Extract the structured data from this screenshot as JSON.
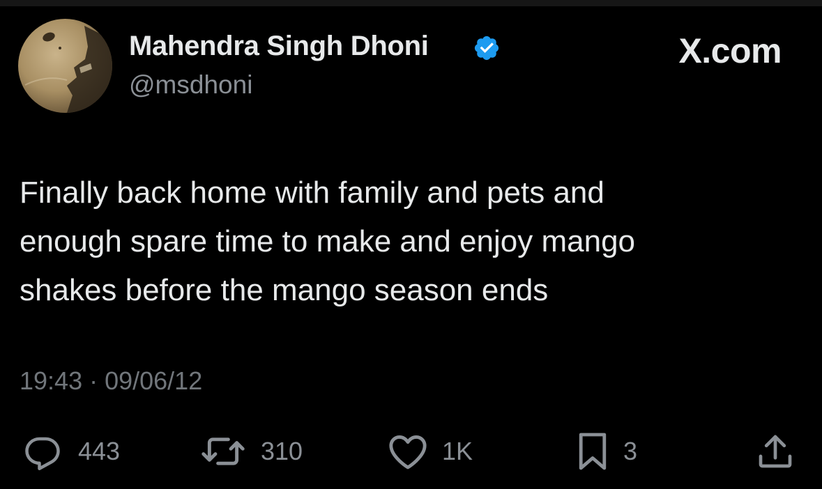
{
  "header": {
    "display_name": "Mahendra Singh Dhoni",
    "handle": "@msdhoni",
    "verified_icon": "verified-badge-icon",
    "brand": "X.com",
    "verified_color": "#1d9bf0"
  },
  "tweet": {
    "lines": [
      "Finally back home with family and pets and",
      "enough spare time to make and enjoy mango",
      "shakes before the mango season ends"
    ],
    "meta": "19:43 · 09/06/12"
  },
  "actions": {
    "reply": {
      "icon": "reply-icon",
      "count": "443"
    },
    "repost": {
      "icon": "repost-icon",
      "count": "310"
    },
    "like": {
      "icon": "heart-icon",
      "count": "1K"
    },
    "bookmark": {
      "icon": "bookmark-icon",
      "count": "3"
    },
    "share": {
      "icon": "share-icon"
    }
  },
  "colors": {
    "background": "#000000",
    "text": "#e7e9ea",
    "secondary_text": "#71767b"
  }
}
